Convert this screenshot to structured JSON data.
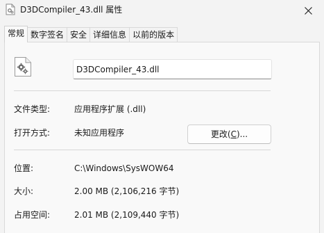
{
  "window": {
    "title": "D3DCompiler_43.dll 属性"
  },
  "tabs": [
    {
      "label": "常规",
      "active": true
    },
    {
      "label": "数字签名",
      "active": false
    },
    {
      "label": "安全",
      "active": false
    },
    {
      "label": "详细信息",
      "active": false
    },
    {
      "label": "以前的版本",
      "active": false
    }
  ],
  "general": {
    "file_name": "D3DCompiler_43.dll",
    "file_type_label": "文件类型:",
    "file_type_value": "应用程序扩展 (.dll)",
    "opens_with_label": "打开方式:",
    "opens_with_value": "未知应用程序",
    "change_button": {
      "prefix": "更改(",
      "accel": "C",
      "suffix": ")..."
    },
    "location_label": "位置:",
    "location_value": "C:\\Windows\\SysWOW64",
    "size_label": "大小:",
    "size_value": "2.00 MB (2,106,216 字节)",
    "size_on_disk_label": "占用空间:",
    "size_on_disk_value": "2.01 MB (2,109,440 字节)"
  },
  "icons": {
    "title": "dll-file-icon",
    "file": "settings-file-icon",
    "close": "close-icon"
  }
}
